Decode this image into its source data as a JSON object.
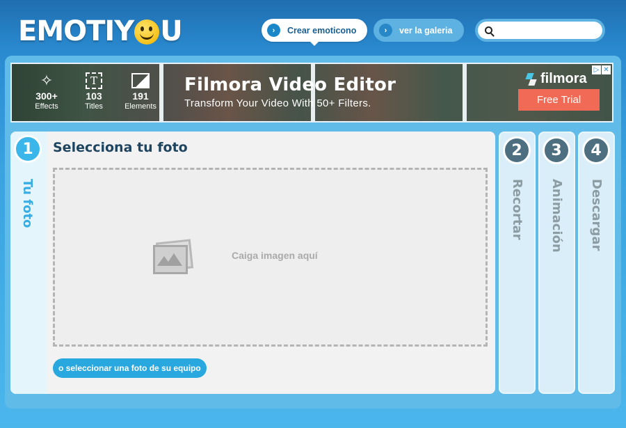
{
  "header": {
    "logo": {
      "left": "EMOTIY",
      "right": "U"
    },
    "nav": [
      {
        "label": "Crear emoticono"
      },
      {
        "label": "ver la galeria"
      }
    ],
    "search": {
      "value": "",
      "placeholder": ""
    }
  },
  "ad": {
    "stats": [
      {
        "icon": "magic-wand-icon",
        "value": "300+",
        "label": "Effects"
      },
      {
        "icon": "text-box-icon",
        "value": "103",
        "label": "Titles"
      },
      {
        "icon": "image-icon",
        "value": "191",
        "label": "Elements"
      }
    ],
    "title": "Filmora Video Editor",
    "subtitle": "Transform Your Video With 50+ Filters.",
    "brand": "filmora",
    "cta": "Free Trial",
    "close_glyphs": [
      "▷",
      "✕"
    ]
  },
  "steps": [
    {
      "number": "1",
      "label": "Tu foto",
      "active": true
    },
    {
      "number": "2",
      "label": "Recortar",
      "active": false
    },
    {
      "number": "3",
      "label": "Animación",
      "active": false
    },
    {
      "number": "4",
      "label": "Descargar",
      "active": false
    }
  ],
  "upload": {
    "heading": "Selecciona tu foto",
    "drop_hint": "Caiga imagen aquí",
    "button": "o seleccionar una foto de su equipo"
  },
  "colors": {
    "accent": "#29a8e0",
    "brand_blue": "#1f6fb0",
    "cta_red": "#f06a55",
    "step_inactive": "#4d6f80"
  }
}
